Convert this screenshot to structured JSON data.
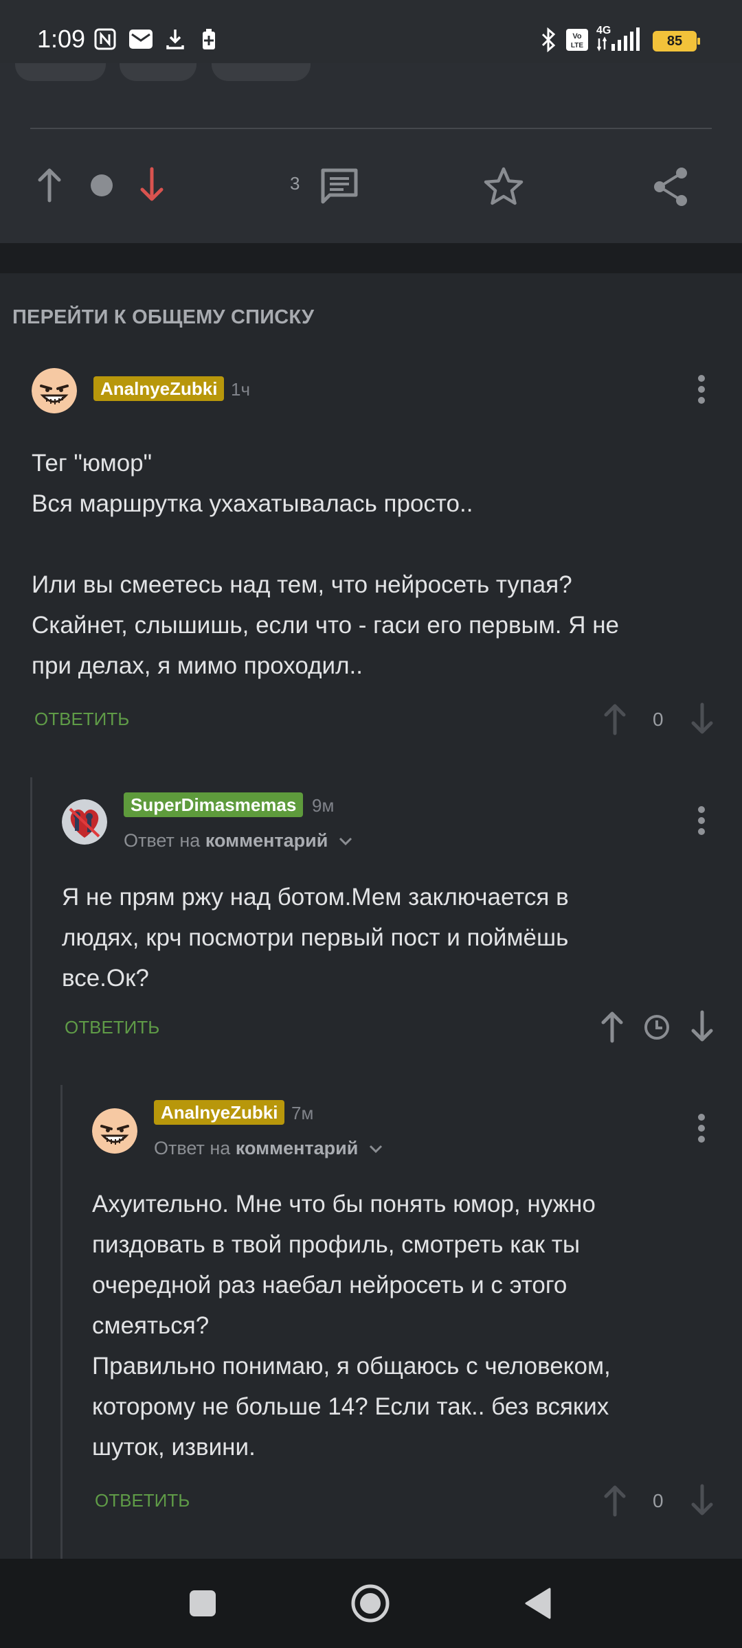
{
  "status_bar": {
    "time": "1:09",
    "battery": "85",
    "network": "4G"
  },
  "post": {
    "comment_count": "3"
  },
  "nav": {
    "all_list_link": "ПЕРЕЙТИ К ОБЩЕМУ СПИСКУ"
  },
  "comments": [
    {
      "author": "AnalnyeZubki",
      "time": "1ч",
      "text": "Тег \"юмор\"\nВся маршрутка ухахатывалась просто..\n\nИли вы смеетесь над тем, что нейросеть тупая?\nСкайнет, слышишь, если что - гаси его первым. Я не\nпри делах, я мимо проходил..",
      "reply_label": "ОТВЕТИТЬ",
      "rating": "0"
    },
    {
      "author": "SuperDimasmemas",
      "time": "9м",
      "reply_prefix": "Ответ на",
      "reply_target": "комментарий",
      "text": "Я не прям ржу над ботом.Мем заключается в\nлюдях, крч посмотри первый пост и поймёшь\nвсе.Ок?",
      "reply_label": "ОТВЕТИТЬ"
    },
    {
      "author": "AnalnyeZubki",
      "time": "7м",
      "reply_prefix": "Ответ на",
      "reply_target": "комментарий",
      "text": "Ахуительно. Мне что бы понять юмор, нужно\nпиздовать в твой профиль, смотреть как ты\nочередной раз наебал нейросеть и с этого\nсмеяться?\nПравильно понимаю, я общаюсь с человеком,\nкоторому не больше 14? Если так.. без всяких\nшуток, извини.",
      "reply_label": "ОТВЕТИТЬ",
      "rating": "0"
    }
  ],
  "colors": {
    "background": "#25282c",
    "accent_green": "#5f9b47",
    "badge_gold": "#b8970b",
    "badge_green": "#5e9b3c",
    "downvote_red": "#d9534f"
  }
}
